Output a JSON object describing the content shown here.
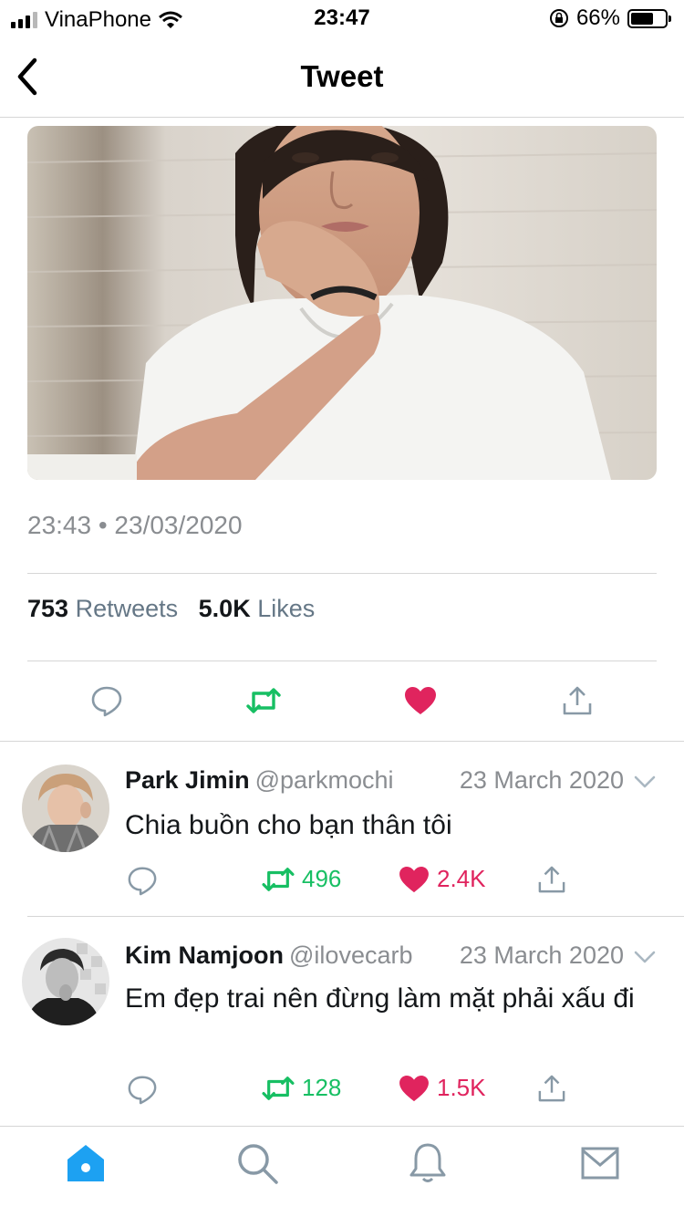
{
  "status_bar": {
    "carrier": "VinaPhone",
    "time": "23:47",
    "battery_percent": "66%",
    "battery_level": 0.66
  },
  "nav": {
    "title": "Tweet",
    "back_icon": "chevron-left-icon"
  },
  "tweet": {
    "timestamp": "23:43 • 23/03/2020",
    "retweet_count": "753",
    "retweet_label": "Retweets",
    "like_count": "5.0K",
    "like_label": "Likes",
    "actions": [
      "reply-icon",
      "retweet-icon",
      "like-icon",
      "share-icon"
    ],
    "retweet_active_color": "#17bf63",
    "like_active_color": "#e0245e"
  },
  "replies": [
    {
      "name": "Park Jimin",
      "handle": "@parkmochi",
      "date": "23 March 2020",
      "text": "Chia buồn cho bạn thân tôi",
      "retweets": "496",
      "likes": "2.4K"
    },
    {
      "name": "Kim Namjoon",
      "handle": "@ilovecarb",
      "date": "23 March 2020",
      "text": "Em đẹp trai nên đừng làm mặt phải xấu đi",
      "retweets": "128",
      "likes": "1.5K"
    }
  ],
  "tabbar": {
    "tabs": [
      "home-icon",
      "search-icon",
      "bell-icon",
      "mail-icon"
    ],
    "active_color": "#1da1f2"
  }
}
